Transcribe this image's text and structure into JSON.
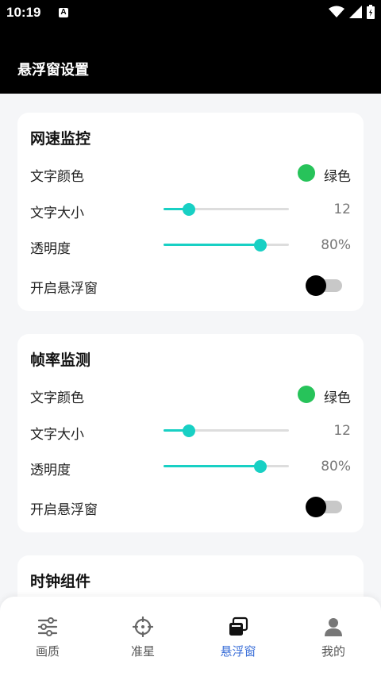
{
  "status": {
    "time": "10:19",
    "notif_letter": "A"
  },
  "header": {
    "title": "悬浮窗设置"
  },
  "sections": [
    {
      "title": "网速监控",
      "text_color_label": "文字颜色",
      "text_color_value": "绿色",
      "text_color_hex": "#27c35a",
      "text_size_label": "文字大小",
      "text_size_value": "12",
      "text_size_level": 0.2,
      "opacity_label": "透明度",
      "opacity_value": "80%",
      "opacity_level": 0.8,
      "toggle_label": "开启悬浮窗",
      "toggle_on": false
    },
    {
      "title": "帧率监测",
      "text_color_label": "文字颜色",
      "text_color_value": "绿色",
      "text_color_hex": "#27c35a",
      "text_size_label": "文字大小",
      "text_size_value": "12",
      "text_size_level": 0.2,
      "opacity_label": "透明度",
      "opacity_value": "80%",
      "opacity_level": 0.8,
      "toggle_label": "开启悬浮窗",
      "toggle_on": false
    },
    {
      "title": "时钟组件"
    }
  ],
  "nav": [
    {
      "label": "画质",
      "icon": "sliders-icon"
    },
    {
      "label": "准星",
      "icon": "crosshair-icon"
    },
    {
      "label": "悬浮窗",
      "icon": "floating-window-icon",
      "active": true
    },
    {
      "label": "我的",
      "icon": "person-icon"
    }
  ],
  "colors": {
    "accent": "#18d0c4",
    "nav_active": "#3b6fd8"
  }
}
